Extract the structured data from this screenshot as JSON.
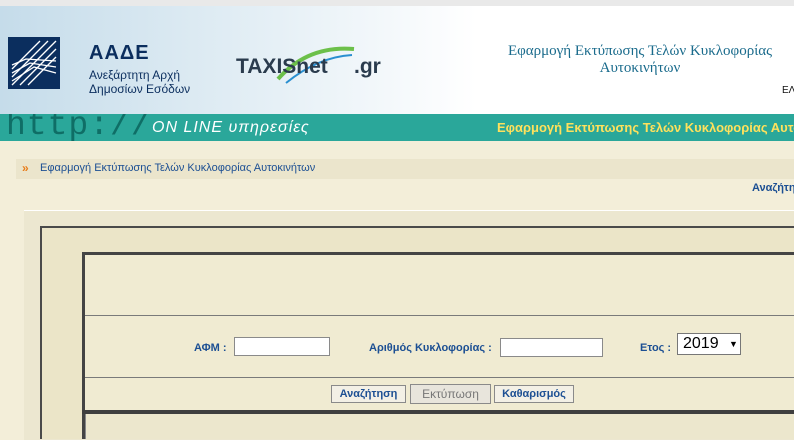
{
  "header": {
    "org_title": "ΑΑΔΕ",
    "org_line1": "Ανεξάρτητη Αρχή",
    "org_line2": "Δημοσίων Εσόδων",
    "taxisnet": "TAXISnet",
    "taxisnet_gr": ".gr",
    "app_title": "Εφαρμογή Εκτύπωσης Τελών Κυκλοφορίας Αυτοκινήτων",
    "lang": "ΕΛ"
  },
  "banner": {
    "http_text": "http://",
    "online_text": "ON LINE υπηρεσίες",
    "title": "Εφαρμογή Εκτύπωσης Τελών Κυκλοφορίας Αυτοκινήτων"
  },
  "breadcrumb": {
    "icon": "double-chevron-right-icon",
    "text": "Εφαρμογή Εκτύπωσης Τελών Κυκλοφορίας Αυτοκινήτων"
  },
  "search_link": "Αναζήτηση",
  "form": {
    "afm_label": "ΑΦΜ :",
    "afm_value": "",
    "plate_label": "Αριθμός Κυκλοφορίας :",
    "plate_value": "",
    "year_label": "Ετος :",
    "year_value": "2019"
  },
  "buttons": {
    "search": "Αναζήτηση",
    "print": "Εκτύπωση",
    "clear": "Καθαρισμός"
  },
  "colors": {
    "banner": "#2aa79a",
    "banner_title": "#ffe15c",
    "label_blue": "#1c4f93",
    "page_bg": "#f3eed9"
  }
}
